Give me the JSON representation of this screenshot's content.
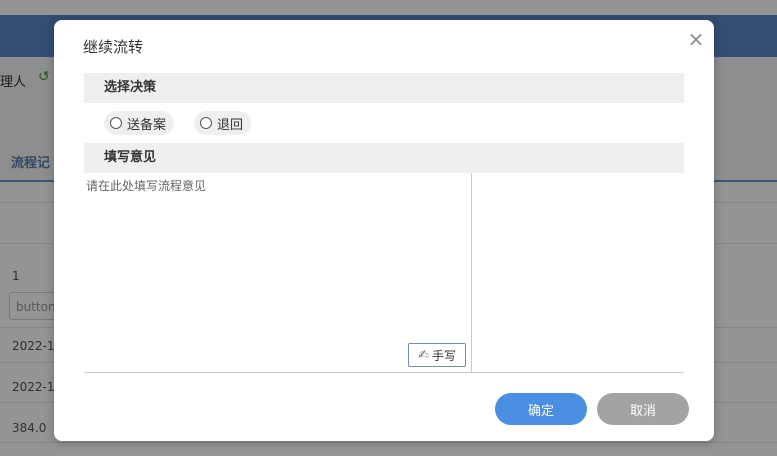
{
  "background": {
    "toolbar_label": "理人",
    "tab_label": "流程记",
    "row_number": "1",
    "button_text": "button",
    "dates": [
      "2022-1",
      "2022-1"
    ],
    "value": "384.0"
  },
  "dialog": {
    "title": "继续流转",
    "close_symbol": "×",
    "decision_section": "选择决策",
    "options": [
      "送备案",
      "退回"
    ],
    "opinion_section": "填写意见",
    "opinion_placeholder": "请在此处填写流程意见",
    "handwrite_label": "手写",
    "confirm_label": "确定",
    "cancel_label": "取消"
  },
  "colors": {
    "primary": "#4a8fe2",
    "cancel": "#a3a3a3",
    "header_bar": "#5a86c7"
  }
}
